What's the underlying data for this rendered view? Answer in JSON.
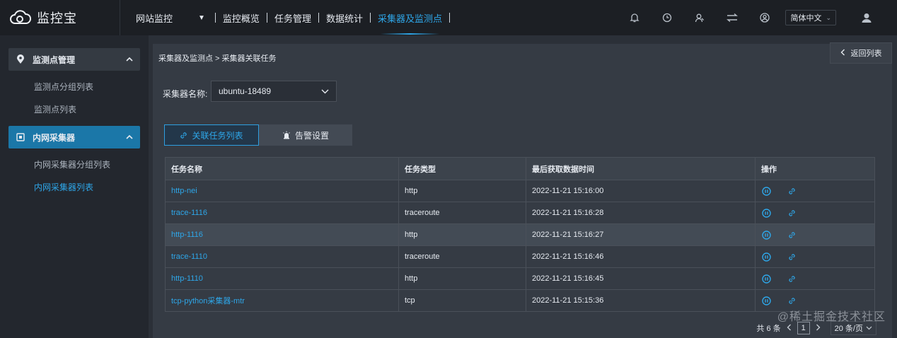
{
  "brand": {
    "name": "监控宝",
    "accent_color": "#2ea6e8"
  },
  "topnav": {
    "module": "网站监控",
    "items": [
      "监控概览",
      "任务管理",
      "数据统计",
      "采集器及监测点"
    ],
    "active_index": 3
  },
  "header": {
    "language": "简体中文"
  },
  "sidebar": {
    "groups": [
      {
        "label": "监测点管理",
        "icon": "location-pin-icon",
        "active": false,
        "children": [
          {
            "label": "监测点分组列表"
          },
          {
            "label": "监测点列表"
          }
        ]
      },
      {
        "label": "内网采集器",
        "icon": "chip-icon",
        "active": true,
        "children": [
          {
            "label": "内网采集器分组列表"
          },
          {
            "label": "内网采集器列表",
            "active": true
          }
        ]
      }
    ]
  },
  "breadcrumb": "采集器及监测点 > 采集器关联任务",
  "back_button": "返回列表",
  "collector": {
    "label": "采集器名称:",
    "value": "ubuntu-18489"
  },
  "tabs": [
    {
      "label": "关联任务列表",
      "active": true
    },
    {
      "label": "告警设置",
      "active": false
    }
  ],
  "table": {
    "headers": [
      "任务名称",
      "任务类型",
      "最后获取数据时间",
      "操作"
    ],
    "rows": [
      {
        "name": "http-nei",
        "type": "http",
        "time": "2022-11-21 15:16:00"
      },
      {
        "name": "trace-1116",
        "type": "traceroute",
        "time": "2022-11-21 15:16:28"
      },
      {
        "name": "http-1116",
        "type": "http",
        "time": "2022-11-21 15:16:27"
      },
      {
        "name": "trace-1110",
        "type": "traceroute",
        "time": "2022-11-21 15:16:46"
      },
      {
        "name": "http-1110",
        "type": "http",
        "time": "2022-11-21 15:16:45"
      },
      {
        "name": "tcp-python采集器-mtr",
        "type": "tcp",
        "time": "2022-11-21 15:15:36"
      }
    ]
  },
  "pagination": {
    "total": "共 6 条",
    "current": "1",
    "page_size": "20 条/页"
  },
  "watermark": "@稀土掘金技术社区"
}
